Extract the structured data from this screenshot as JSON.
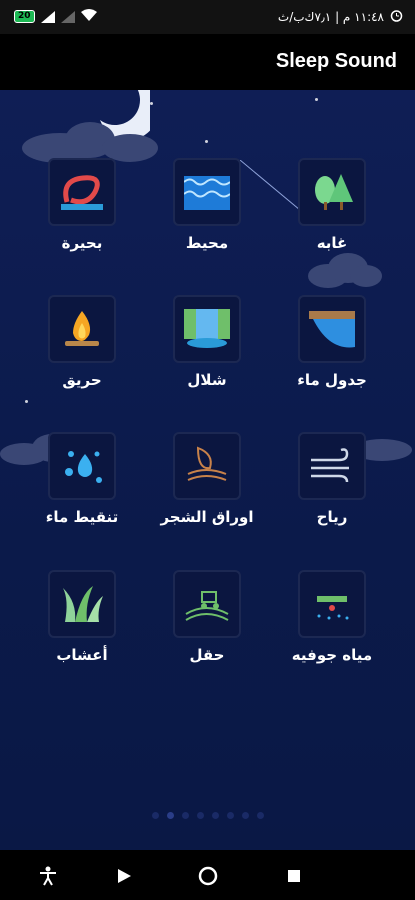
{
  "status": {
    "time": "١١:٤٨ م | ٧٫١ك‌ب/ث",
    "battery": "20",
    "icons": [
      "battery-icon",
      "signal-icon",
      "signal-icon",
      "wifi-icon",
      "alarm-icon"
    ]
  },
  "app": {
    "title": "Sleep Sound"
  },
  "sounds": [
    {
      "label": "غابه",
      "icon": "forest-icon"
    },
    {
      "label": "محيط",
      "icon": "ocean-icon"
    },
    {
      "label": "بحيرة",
      "icon": "lake-icon"
    },
    {
      "label": "جدول ماء",
      "icon": "stream-icon"
    },
    {
      "label": "شلال",
      "icon": "waterfall-icon"
    },
    {
      "label": "حريق",
      "icon": "campfire-icon"
    },
    {
      "label": "رياح",
      "icon": "wind-icon"
    },
    {
      "label": "اوراق الشجر",
      "icon": "leaves-icon"
    },
    {
      "label": "تنقيط ماء",
      "icon": "water-drops-icon"
    },
    {
      "label": "مياه جوفيه",
      "icon": "underground-water-icon"
    },
    {
      "label": "حقل",
      "icon": "field-icon"
    },
    {
      "label": "أعشاب",
      "icon": "grass-icon"
    }
  ],
  "pager": {
    "pages": 8,
    "active": 2
  },
  "nav": [
    "accessibility-icon",
    "play-icon",
    "home-icon",
    "square-icon"
  ],
  "colors": {
    "background": "#0d1a4a",
    "appbar": "#000000",
    "text": "#ffffff"
  }
}
